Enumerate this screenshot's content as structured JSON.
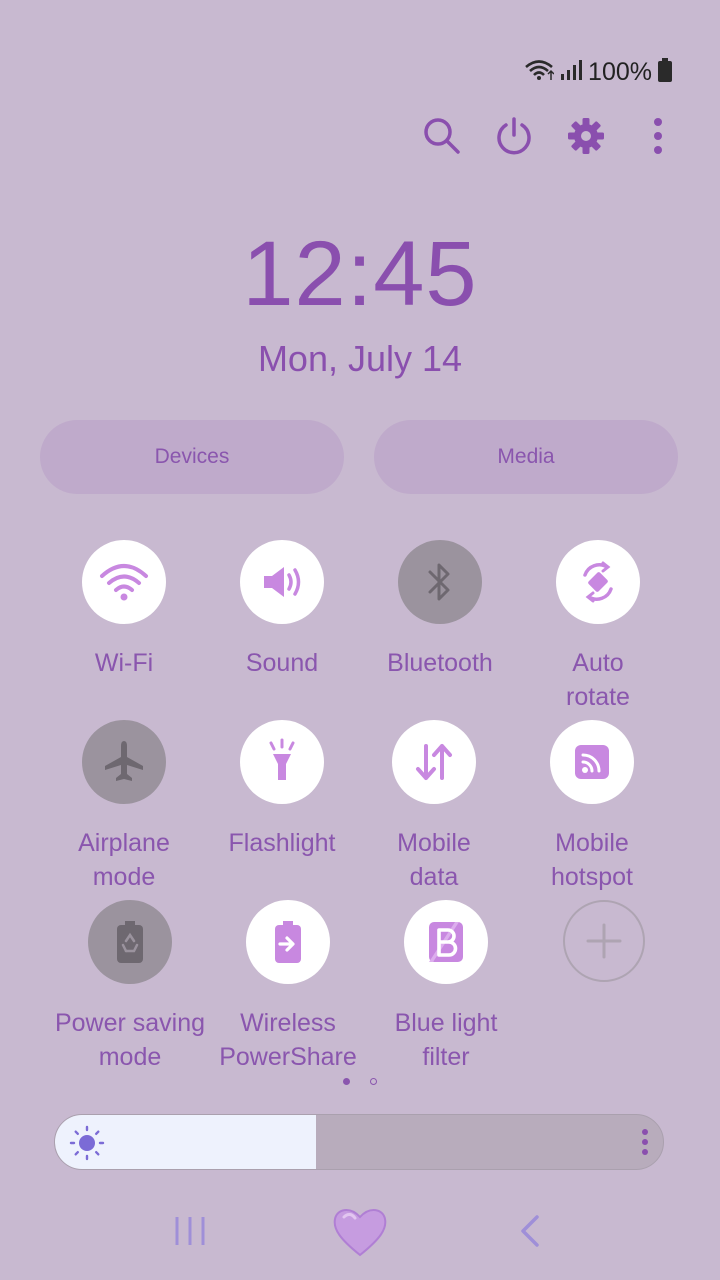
{
  "status": {
    "battery_pct": "100%"
  },
  "toolbar": {
    "icons": [
      "search-icon",
      "power-icon",
      "settings-gear-icon",
      "more-vertical-icon"
    ]
  },
  "clock": {
    "time": "12:45",
    "date": "Mon, July 14"
  },
  "pills": {
    "devices": "Devices",
    "media": "Media"
  },
  "tiles": [
    {
      "label": "Wi-Fi",
      "state": "on",
      "icon": "wifi-icon"
    },
    {
      "label": "Sound",
      "state": "on",
      "icon": "speaker-icon"
    },
    {
      "label": "Bluetooth",
      "state": "off",
      "icon": "bluetooth-icon"
    },
    {
      "label": "Auto\nrotate",
      "state": "on",
      "icon": "auto-rotate-icon"
    },
    {
      "label": "Airplane\nmode",
      "state": "off",
      "icon": "airplane-icon"
    },
    {
      "label": "Flashlight",
      "state": "on",
      "icon": "flashlight-icon"
    },
    {
      "label": "Mobile\ndata",
      "state": "on",
      "icon": "mobile-data-icon"
    },
    {
      "label": "Mobile\nhotspot",
      "state": "on",
      "icon": "hotspot-icon"
    },
    {
      "label": "Power saving\nmode",
      "state": "off",
      "icon": "power-saving-icon"
    },
    {
      "label": "Wireless\nPowerShare",
      "state": "on",
      "icon": "wireless-powershare-icon"
    },
    {
      "label": "Blue light\nfilter",
      "state": "on",
      "icon": "blue-light-filter-icon"
    }
  ],
  "pager": {
    "current_page": 1,
    "total_pages": 2
  },
  "brightness": {
    "level": 0.43
  },
  "colors": {
    "accent": "#8a56ae",
    "background": "#c8b9d0",
    "tile_on": "#ffffff",
    "tile_off": "#9b939e",
    "icon_on": "#c888e0"
  }
}
